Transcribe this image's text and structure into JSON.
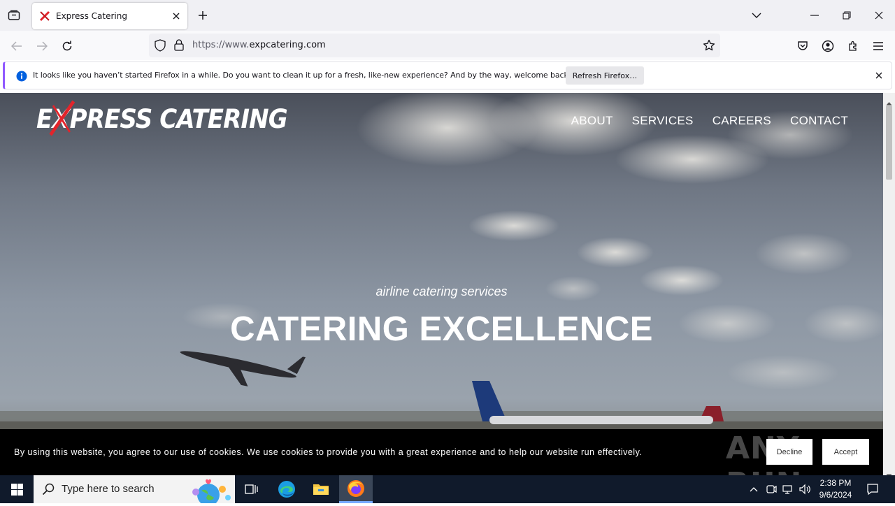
{
  "browser": {
    "tab_title": "Express Catering",
    "url_prefix": "https://www.",
    "url_host": "expcatering.com",
    "notification_text": "It looks like you haven’t started Firefox in a while. Do you want to clean it up for a fresh, like-new experience? And by the way, welcome back!",
    "refresh_label": "Refresh Firefox…"
  },
  "site": {
    "logo_prefix": "E",
    "logo_x": "X",
    "logo_rest": "PRESS CATERING",
    "nav": [
      "ABOUT",
      "SERVICES",
      "CAREERS",
      "CONTACT"
    ],
    "hero_subtitle": "airline catering services",
    "hero_title": "CATERING EXCELLENCE"
  },
  "cookie": {
    "text": "By using this website, you agree to our use of cookies. We use cookies to provide you with a great experience and to help our website run effectively.",
    "decline_label": "Decline",
    "accept_label": "Accept",
    "watermark": "ANY RUN"
  },
  "taskbar": {
    "search_placeholder": "Type here to search",
    "time": "2:38 PM",
    "date": "9/6/2024"
  },
  "colors": {
    "accent": "#9059ff",
    "brand_red": "#e3242b",
    "taskbar": "#101a2b"
  }
}
